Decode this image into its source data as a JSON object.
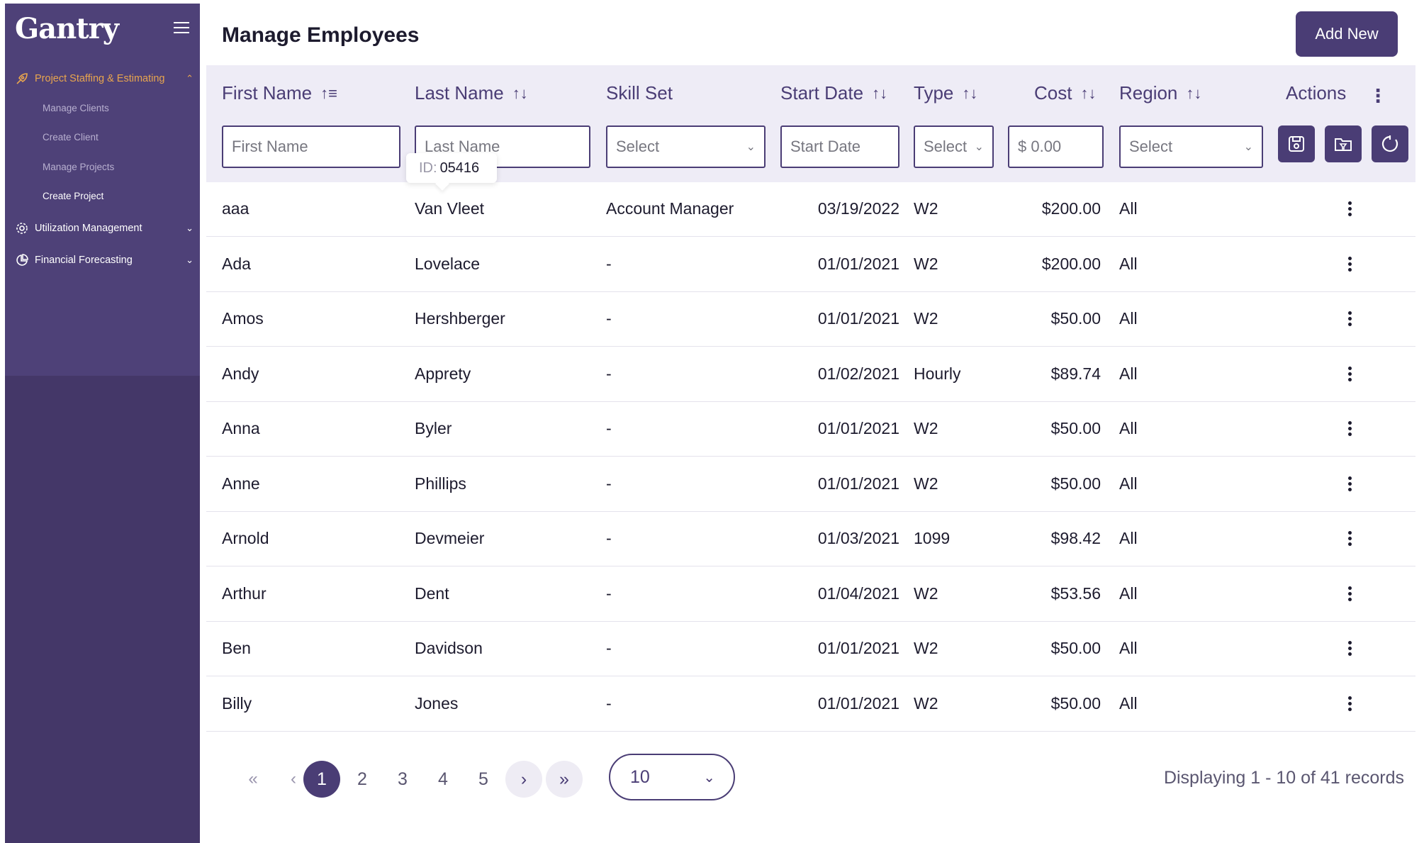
{
  "app": {
    "logo": "Gantry"
  },
  "sidebar": {
    "sections": [
      {
        "label": "Project Staffing & Estimating",
        "icon": "rocket-icon",
        "expanded": true,
        "items": [
          "Manage Clients",
          "Create Client",
          "Manage Projects",
          "Create Project"
        ],
        "current": "Create Project"
      },
      {
        "label": "Utilization Management",
        "icon": "gear-icon",
        "expanded": false
      },
      {
        "label": "Financial Forecasting",
        "icon": "pie-chart-icon",
        "expanded": false
      }
    ]
  },
  "header": {
    "title": "Manage Employees",
    "add_label": "Add New"
  },
  "table": {
    "columns": [
      {
        "label": "First Name",
        "sort": "ascending"
      },
      {
        "label": "Last Name",
        "sort": "sortable"
      },
      {
        "label": "Skill Set",
        "sort": "none"
      },
      {
        "label": "Start Date",
        "sort": "sortable"
      },
      {
        "label": "Type",
        "sort": "sortable"
      },
      {
        "label": "Cost",
        "sort": "sortable"
      },
      {
        "label": "Region",
        "sort": "sortable"
      },
      {
        "label": "Actions",
        "sort": "none"
      }
    ],
    "filters": {
      "first_name_placeholder": "First Name",
      "last_name_placeholder": "Last Name",
      "skill_select": "Select",
      "start_date_placeholder": "Start Date",
      "type_select": "Select",
      "cost_placeholder": "$ 0.00",
      "region_select": "Select"
    },
    "tooltip": {
      "label": "ID:",
      "value": "05416"
    },
    "rows": [
      [
        "aaa",
        "Van Vleet",
        "Account Manager",
        "03/19/2022",
        "W2",
        "$200.00",
        "All"
      ],
      [
        "Ada",
        "Lovelace",
        "-",
        "01/01/2021",
        "W2",
        "$200.00",
        "All"
      ],
      [
        "Amos",
        "Hershberger",
        "-",
        "01/01/2021",
        "W2",
        "$50.00",
        "All"
      ],
      [
        "Andy",
        "Apprety",
        "-",
        "01/02/2021",
        "Hourly",
        "$89.74",
        "All"
      ],
      [
        "Anna",
        "Byler",
        "-",
        "01/01/2021",
        "W2",
        "$50.00",
        "All"
      ],
      [
        "Anne",
        "Phillips",
        "-",
        "01/01/2021",
        "W2",
        "$50.00",
        "All"
      ],
      [
        "Arnold",
        "Devmeier",
        "-",
        "01/03/2021",
        "1099",
        "$98.42",
        "All"
      ],
      [
        "Arthur",
        "Dent",
        "-",
        "01/04/2021",
        "W2",
        "$53.56",
        "All"
      ],
      [
        "Ben",
        "Davidson",
        "-",
        "01/01/2021",
        "W2",
        "$50.00",
        "All"
      ],
      [
        "Billy",
        "Jones",
        "-",
        "01/01/2021",
        "W2",
        "$50.00",
        "All"
      ]
    ]
  },
  "pagination": {
    "first": "«",
    "prev": "‹",
    "next": "›",
    "last": "»",
    "pages": [
      "1",
      "2",
      "3",
      "4",
      "5"
    ],
    "current": "1",
    "rows_per_page": "10",
    "summary": "Displaying 1 - 10 of 41 records"
  },
  "colors": {
    "primary": "#4a3d75",
    "sidebar": "#443768",
    "active_nav": "#e8a54e",
    "header_bg": "#eeecf6"
  }
}
